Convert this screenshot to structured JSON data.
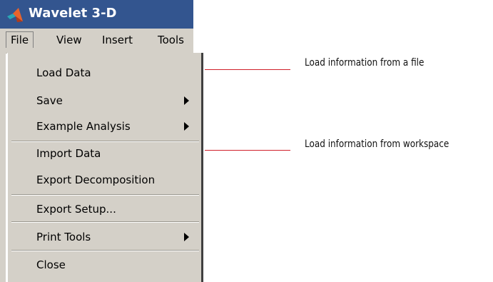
{
  "window": {
    "title": "Wavelet 3-D",
    "icon": "matlab-logo-icon"
  },
  "menubar": {
    "items": [
      "File",
      "View",
      "Insert",
      "Tools"
    ]
  },
  "file_menu": {
    "items": [
      {
        "label": "Load Data",
        "submenu": false
      },
      {
        "label": "Save",
        "submenu": true
      },
      {
        "label": "Example Analysis",
        "submenu": true
      },
      {
        "label": "Import Data",
        "submenu": false
      },
      {
        "label": "Export Decomposition",
        "submenu": false
      },
      {
        "label": "Export Setup...",
        "submenu": false
      },
      {
        "label": "Print Tools",
        "submenu": true
      },
      {
        "label": "Close",
        "submenu": false
      }
    ]
  },
  "callouts": [
    {
      "text": "Load information from a file"
    },
    {
      "text": "Load information from workspace"
    }
  ],
  "colors": {
    "titlebar": "#33558f",
    "menu": "#d4d0c8",
    "callout_line": "#d0202a"
  }
}
